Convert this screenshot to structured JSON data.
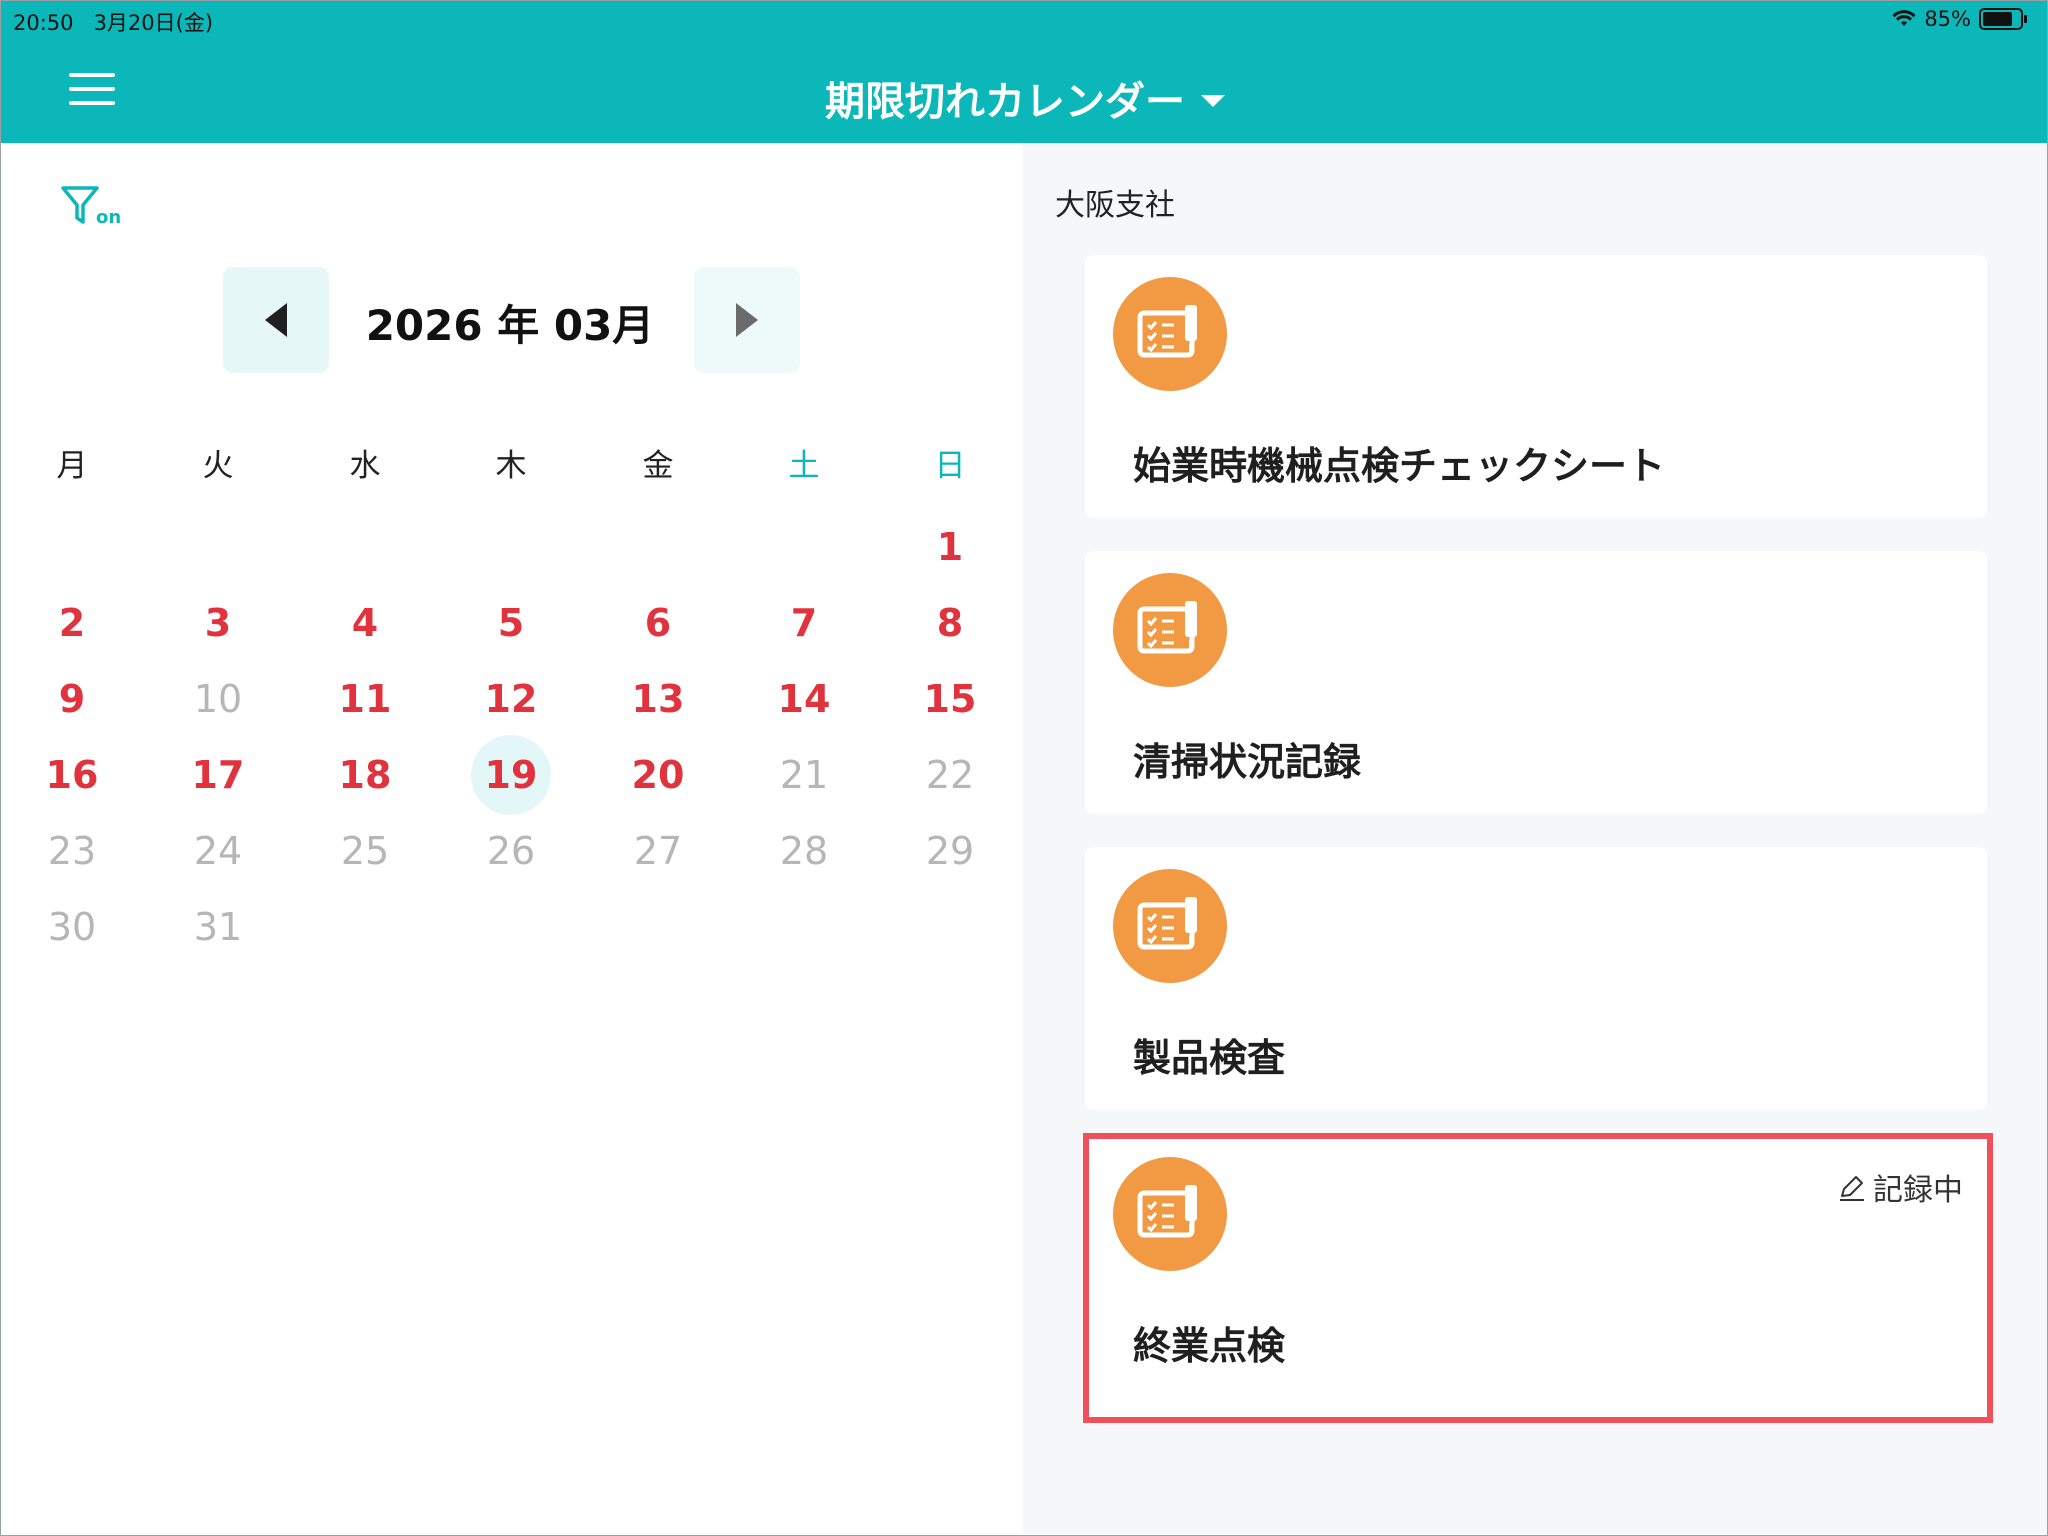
{
  "status_bar": {
    "time": "20:50",
    "date": "3月20日(金)",
    "battery": "85%",
    "battery_level": 0.85
  },
  "header": {
    "title": "期限切れカレンダー"
  },
  "filter": {
    "state": "on"
  },
  "calendar": {
    "month_label": "2026 年 03月",
    "weekdays": [
      "月",
      "火",
      "水",
      "木",
      "金",
      "土",
      "日"
    ],
    "days": [
      "1",
      "2",
      "3",
      "4",
      "5",
      "6",
      "7",
      "8",
      "9",
      "10",
      "11",
      "12",
      "13",
      "14",
      "15",
      "16",
      "17",
      "18",
      "19",
      "20",
      "21",
      "22",
      "23",
      "24",
      "25",
      "26",
      "27",
      "28",
      "29",
      "30",
      "31"
    ],
    "overdue_days": [
      1,
      2,
      3,
      4,
      5,
      6,
      7,
      8,
      9,
      11,
      12,
      13,
      14,
      15,
      16,
      17,
      18,
      19,
      20
    ],
    "today": 19
  },
  "location": "大阪支社",
  "cards": [
    {
      "title": "始業時機械点検チェックシート"
    },
    {
      "title": "清掃状況記録"
    },
    {
      "title": "製品検査"
    },
    {
      "title": "終業点検",
      "status": "記録中"
    }
  ],
  "colors": {
    "header": "#0bb7b9",
    "overdue": "#e0333d",
    "icon_bg": "#f29a43",
    "highlight": "#f0505a"
  }
}
